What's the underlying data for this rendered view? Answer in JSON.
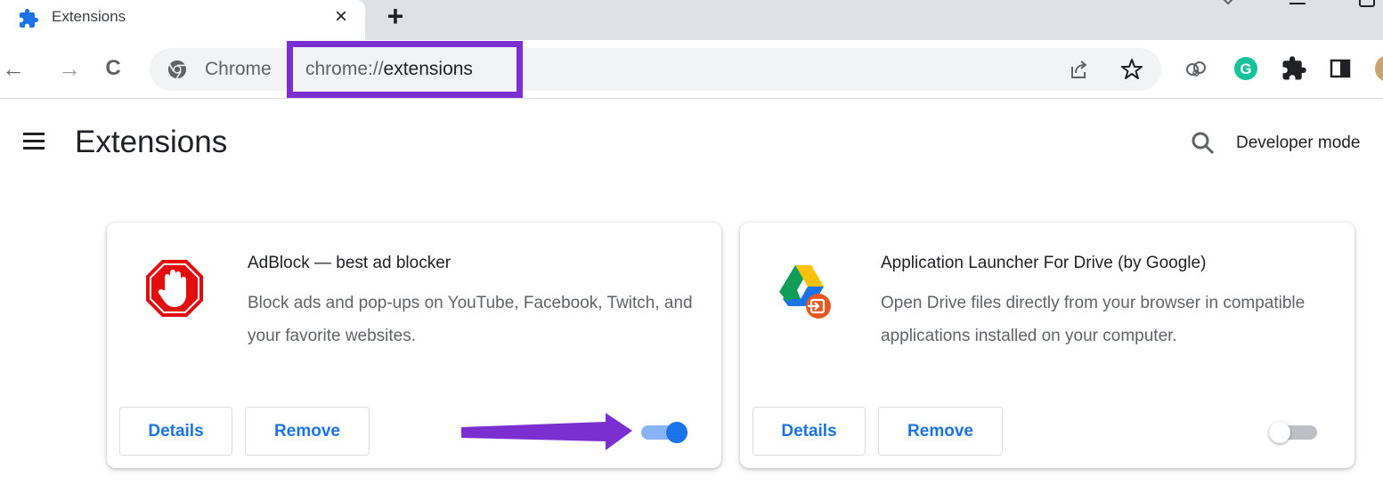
{
  "tab": {
    "title": "Extensions",
    "close_glyph": "×",
    "new_tab_glyph": "+"
  },
  "toolbar": {
    "back_glyph": "←",
    "forward_glyph": "→",
    "reload_glyph": "C",
    "chip_label": "Chrome",
    "url_scheme": "chrome://",
    "url_path": "extensions"
  },
  "page": {
    "title": "Extensions",
    "developer_mode_label": "Developer mode"
  },
  "extensions": [
    {
      "name": "AdBlock — best ad blocker",
      "description": "Block ads and pop-ups on YouTube, Facebook, Twitch, and your favorite websites.",
      "details_label": "Details",
      "remove_label": "Remove",
      "enabled": true
    },
    {
      "name": "Application Launcher For Drive (by Google)",
      "description": "Open Drive files directly from your browser in compatible applications installed on your computer.",
      "details_label": "Details",
      "remove_label": "Remove",
      "enabled": false
    }
  ],
  "colors": {
    "annotation": "#7b2fd1",
    "accent": "#1a73e8"
  }
}
